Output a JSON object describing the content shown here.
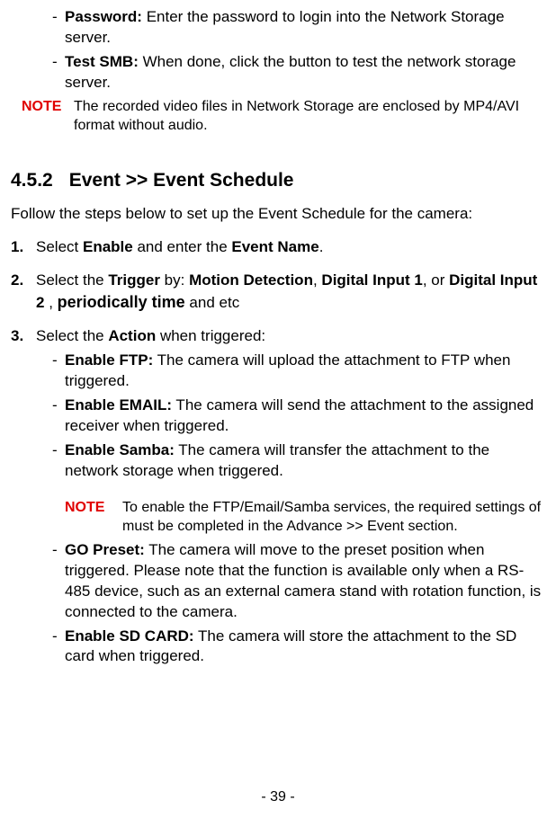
{
  "top_bullets": {
    "dash": "-",
    "password": {
      "label": "Password:",
      "text": " Enter the password to login into the Network Storage server."
    },
    "testsmb": {
      "label": "Test SMB:",
      "text": " When done, click the button to test the network storage server."
    }
  },
  "note1": {
    "label": "NOTE",
    "text": "The recorded video files in Network Storage are enclosed by MP4/AVI format without audio."
  },
  "heading": {
    "num": "4.5.2",
    "title": "Event >> Event Schedule"
  },
  "intro": "Follow the steps below to set up the Event Schedule for the camera:",
  "steps": {
    "s1": {
      "marker": "1.",
      "t1": "Select ",
      "b1": "Enable",
      "t2": " and enter the ",
      "b2": "Event Name",
      "t3": "."
    },
    "s2": {
      "marker": "2.",
      "t1": "Select the ",
      "b1": "Trigger",
      "t2": " by: ",
      "b2": "Motion Detection",
      "t3": ", ",
      "b3": "Digital Input 1",
      "t4": ", or ",
      "b4": "Digital Input 2",
      "t5": " , ",
      "b5": "periodically time",
      "t6": " and etc"
    },
    "s3": {
      "marker": "3.",
      "t1": "Select the ",
      "b1": "Action",
      "t2": " when triggered:"
    }
  },
  "action_bullets": {
    "ftp": {
      "label": "Enable FTP:",
      "text": " The camera will upload the attachment to FTP when triggered."
    },
    "email": {
      "label": "Enable EMAIL:",
      "text": " The camera will send the attachment to the assigned receiver when triggered."
    },
    "samba": {
      "label": "Enable Samba:",
      "text": " The camera will transfer the attachment to the network storage when triggered."
    },
    "gopreset": {
      "label": "GO Preset:",
      "text": " The camera will move to the preset position when triggered. Please note that the function is available only when a RS-485 device, such as an external camera stand with rotation function, is connected to the camera."
    },
    "sdcard": {
      "label": "Enable SD CARD:",
      "text": " The camera will store the attachment to the SD card when triggered."
    }
  },
  "note2": {
    "label": "NOTE",
    "text": "To enable the FTP/Email/Samba services, the required settings of must be completed in the Advance >> Event section."
  },
  "page_number": "- 39 -"
}
